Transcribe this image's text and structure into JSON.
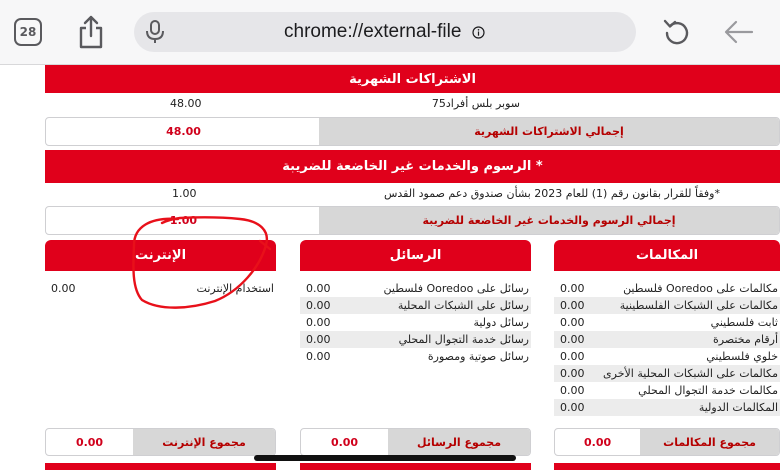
{
  "browser": {
    "tab_count": "28",
    "url": "chrome://external-file",
    "icons": [
      "tabs-icon",
      "share-icon",
      "microphone-icon",
      "info-icon",
      "reload-icon",
      "back-arrow-icon"
    ]
  },
  "monthly": {
    "header": "الاشتراكات الشهرية",
    "item_label": "سوبر بلس أفراد75",
    "item_value": "48.00",
    "total_label": "إجمالي الاشتراكات الشهرية",
    "total_value": "48.00"
  },
  "fees": {
    "header": "* الرسوم والخدمات غير الخاضعة للضريبة",
    "item_label": "*وفقاً للقرار بقانون رقم (1) للعام 2023 بشأن صندوق دعم صمود القدس",
    "item_value": "1.00",
    "total_label": "إجمالي الرسوم والخدمات غير الخاضعة للضريبة",
    "total_value": "1.00"
  },
  "calls": {
    "header": "المكالمات",
    "rows": [
      {
        "label": "مكالمات على Ooredoo فلسطين",
        "value": "0.00"
      },
      {
        "label": "مكالمات على الشبكات الفلسطينية",
        "value": "0.00"
      },
      {
        "label": "ثابت فلسطيني",
        "value": "0.00"
      },
      {
        "label": "أرقام مختصرة",
        "value": "0.00"
      },
      {
        "label": "خلوي فلسطيني",
        "value": "0.00"
      },
      {
        "label": "مكالمات على الشبكات المحلية الأخرى",
        "value": "0.00"
      },
      {
        "label": "مكالمات خدمة التجوال المحلي",
        "value": "0.00"
      },
      {
        "label": "المكالمات الدولية",
        "value": "0.00"
      }
    ],
    "total_label": "مجموع المكالمات",
    "total_value": "0.00"
  },
  "messages": {
    "header": "الرسائل",
    "rows": [
      {
        "label": "رسائل على Ooredoo فلسطين",
        "value": "0.00"
      },
      {
        "label": "رسائل على الشبكات المحلية",
        "value": "0.00"
      },
      {
        "label": "رسائل دولية",
        "value": "0.00"
      },
      {
        "label": "رسائل خدمة التجوال المحلي",
        "value": "0.00"
      },
      {
        "label": "رسائل صوتية ومصورة",
        "value": "0.00"
      }
    ],
    "total_label": "مجموع الرسائل",
    "total_value": "0.00"
  },
  "internet": {
    "header": "الإنترنت",
    "rows": [
      {
        "label": "استخدام الإنترنت",
        "value": "0.00"
      }
    ],
    "total_label": "مجموع الإنترنت",
    "total_value": "0.00"
  },
  "colors": {
    "brand_red": "#e0001b",
    "annotation_red": "#e8101a",
    "total_label_bg": "#d7d7d7"
  }
}
